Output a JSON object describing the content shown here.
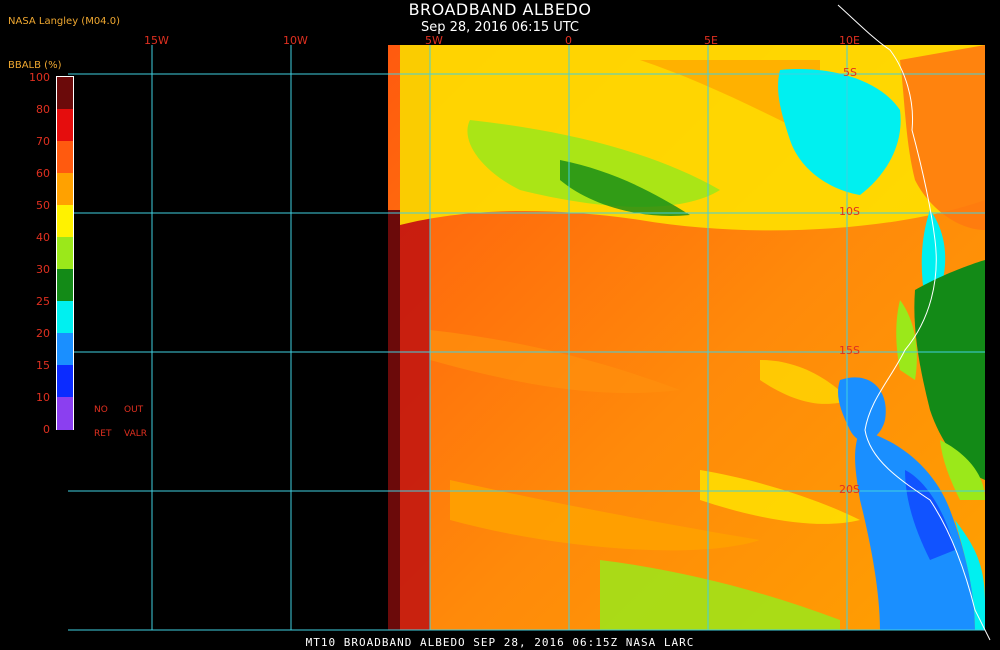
{
  "header": {
    "title": "BROADBAND ALBEDO",
    "subtitle": "Sep 28, 2016 06:15 UTC",
    "agency": "NASA Langley (M04.0)"
  },
  "longitudes": [
    "15W",
    "10W",
    "5W",
    "0",
    "5E",
    "10E"
  ],
  "latitudes": [
    "5S",
    "10S",
    "15S",
    "20S"
  ],
  "legend": {
    "title": "BBALB (%)",
    "ticks": [
      "100",
      "80",
      "70",
      "60",
      "50",
      "40",
      "30",
      "25",
      "20",
      "15",
      "10",
      "0"
    ],
    "colors": [
      "#6b0a0a",
      "#e50d0d",
      "#ff5a0f",
      "#ffa100",
      "#fff200",
      "#9be81a",
      "#138a17",
      "#00f0f0",
      "#1a8fff",
      "#0b2bff",
      "#8b3ff0"
    ],
    "key_no": "NO",
    "key_out": "OUT",
    "key_ret": "RET",
    "key_valr": "VALR"
  },
  "footer": "MT10  BROADBAND ALBEDO  SEP 28, 2016 06:15Z  NASA LARC"
}
